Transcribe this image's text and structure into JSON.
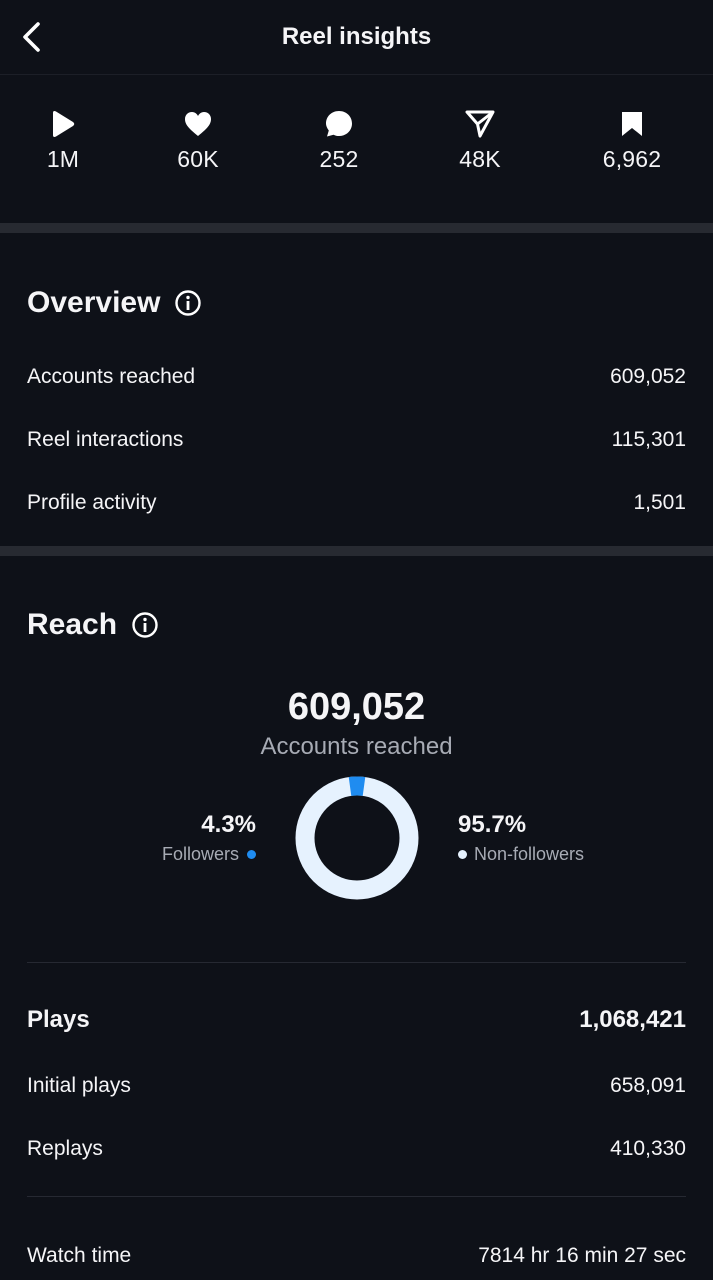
{
  "header": {
    "title": "Reel insights"
  },
  "stats": [
    {
      "icon": "play-icon",
      "value": "1M"
    },
    {
      "icon": "heart-icon",
      "value": "60K"
    },
    {
      "icon": "comment-icon",
      "value": "252"
    },
    {
      "icon": "share-icon",
      "value": "48K"
    },
    {
      "icon": "bookmark-icon",
      "value": "6,962"
    }
  ],
  "overview": {
    "title": "Overview",
    "rows": [
      {
        "label": "Accounts reached",
        "value": "609,052"
      },
      {
        "label": "Reel interactions",
        "value": "115,301"
      },
      {
        "label": "Profile activity",
        "value": "1,501"
      }
    ]
  },
  "reach": {
    "title": "Reach",
    "total": "609,052",
    "total_label": "Accounts reached",
    "followers_pct": "4.3%",
    "followers_label": "Followers",
    "followers_fraction": 0.043,
    "non_followers_pct": "95.7%",
    "non_followers_label": "Non-followers",
    "colors": {
      "followers": "#1f8cf0",
      "non_followers": "#e6f2fe"
    }
  },
  "plays": {
    "label": "Plays",
    "value": "1,068,421",
    "rows": [
      {
        "label": "Initial plays",
        "value": "658,091"
      },
      {
        "label": "Replays",
        "value": "410,330"
      }
    ]
  },
  "watch_time": {
    "label": "Watch time",
    "value": "7814 hr 16 min 27 sec"
  }
}
